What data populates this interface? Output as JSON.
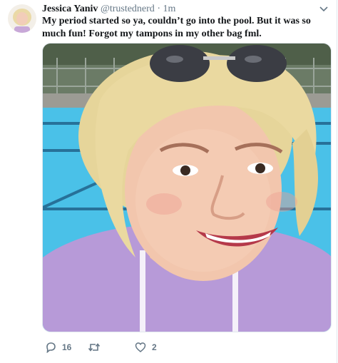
{
  "tweet": {
    "author_name": "Jessica Yaniv",
    "author_handle": "@trustednerd",
    "separator": "·",
    "time": "1m",
    "text": "My period started so ya, couldn’t go into the pool. But it was so much fun! Forgot my tampons in my other bag fml.",
    "media_icon": "selfie-photo",
    "actions": {
      "reply_count": "16",
      "retweet_count": "",
      "like_count": "2"
    }
  },
  "colors": {
    "text": "#14171a",
    "secondary": "#657786",
    "border": "#e1e8ed",
    "pool": "#3fb9e3"
  }
}
